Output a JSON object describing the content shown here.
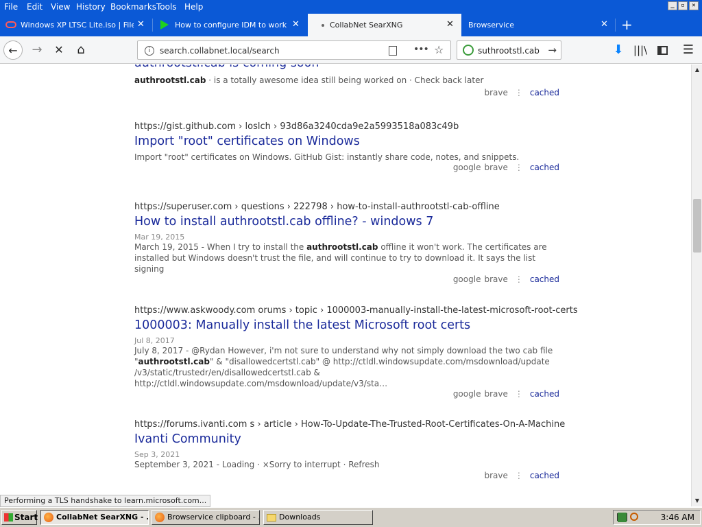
{
  "menubar": {
    "items": [
      "File",
      "Edit",
      "View",
      "History",
      "Bookmarks",
      "Tools",
      "Help"
    ],
    "window_buttons": [
      "_",
      "▫",
      "✕"
    ]
  },
  "tabs": [
    {
      "title": "Windows XP LTSC Lite.iso | Files.fm",
      "icon": "files-fm-icon",
      "active": false
    },
    {
      "title": "How to configure IDM to work with…",
      "icon": "play-arrow-icon",
      "active": false
    },
    {
      "title": "CollabNet SearXNG",
      "icon": "dot-icon",
      "active": true
    },
    {
      "title": "Browservice",
      "icon": "",
      "active": false
    }
  ],
  "new_tab_label": "+",
  "navbar": {
    "url": "search.collabnet.local/search",
    "search_term": "suthrootstl.cab"
  },
  "results": [
    {
      "title": "authrootstl.cab is coming soon",
      "snippet_bold": "authrootstl.cab",
      "snippet_rest": " · is a totally awesome idea still being worked on · Check back later",
      "engines": [
        "brave"
      ],
      "cached": "cached"
    },
    {
      "url": "https://gist.github.com  › loslch › 93d86a3240cda9e2a5993518a083c49b",
      "title": "Import \"root\" certificates on Windows",
      "snippet": "Import \"root\" certificates on Windows. GitHub Gist: instantly share code, notes, and snippets.",
      "engines": [
        "google",
        "brave"
      ],
      "cached": "cached"
    },
    {
      "url": "https://superuser.com  › questions › 222798 › how-to-install-authrootstl-cab-offline",
      "title": "How to install authrootstl.cab offline? - windows 7",
      "date": "Mar 19, 2015",
      "snippet_pre": "March 19, 2015 - When I try to install the ",
      "snippet_bold": "authrootstl.cab",
      "snippet_post": " offline it won't work. The certificates are installed but Windows doesn't trust the file, and will continue to try to download it. It says the list signing",
      "engines": [
        "google",
        "brave"
      ],
      "cached": "cached"
    },
    {
      "url": "https://www.askwoody.com  orums › topic › 1000003-manually-install-the-latest-microsoft-root-certs",
      "title": "1000003: Manually install the latest Microsoft root certs",
      "date": "Jul 8, 2017",
      "snippet_pre": "July 8, 2017 - @Rydan However, i'm not sure to understand why not simply download the two cab file \"",
      "snippet_bold": "authrootstl.cab",
      "snippet_post": "\" & \"disallowedcertstl.cab\" @ http://ctldl.windowsupdate.com/msdownload/update /v3/static/trustedr/en/disallowedcertstl.cab & http://ctldl.windowsupdate.com/msdownload/update/v3/sta…",
      "engines": [
        "google",
        "brave"
      ],
      "cached": "cached"
    },
    {
      "url": "https://forums.ivanti.com  s › article › How-To-Update-The-Trusted-Root-Certificates-On-A-Machine",
      "title": "Ivanti Community",
      "date": "Sep 3, 2021",
      "snippet": "September 3, 2021 - Loading · ×Sorry to interrupt · Refresh",
      "engines": [
        "brave"
      ],
      "cached": "cached"
    }
  ],
  "status_text": "Performing a TLS handshake to learn.microsoft.com...",
  "taskbar": {
    "start_label": "Start",
    "items": [
      {
        "label": "CollabNet SearXNG - ...",
        "active": true
      },
      {
        "label": "Browservice clipboard - ...",
        "active": false
      },
      {
        "label": "Downloads",
        "active": false
      }
    ],
    "clock": "3:46 AM"
  },
  "colors": {
    "titlebar_blue": "#0b59d6",
    "link_blue": "#1a2a9a",
    "taskbar_gray": "#d4d0c8"
  }
}
